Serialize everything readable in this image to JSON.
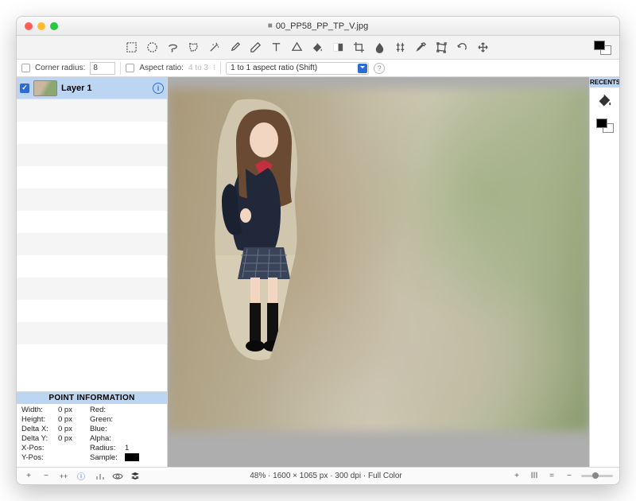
{
  "window": {
    "modified_mark": "■",
    "title": "00_PP58_PP_TP_V.jpg"
  },
  "optionbar": {
    "corner_radius_label": "Corner radius:",
    "corner_radius_value": "8",
    "aspect_label": "Aspect ratio:",
    "aspect_value": "4 to 3",
    "preset_value": "1 to 1 aspect ratio (Shift)"
  },
  "layers": {
    "items": [
      {
        "name": "Layer 1",
        "visible": true
      }
    ]
  },
  "point_info": {
    "header": "POINT INFORMATION",
    "width_label": "Width:",
    "width_value": "0 px",
    "height_label": "Height:",
    "height_value": "0 px",
    "deltax_label": "Delta X:",
    "deltax_value": "0 px",
    "deltay_label": "Delta Y:",
    "deltay_value": "0 px",
    "xpos_label": "X-Pos:",
    "xpos_value": "",
    "ypos_label": "Y-Pos:",
    "ypos_value": "",
    "red_label": "Red:",
    "green_label": "Green:",
    "blue_label": "Blue:",
    "alpha_label": "Alpha:",
    "radius_label": "Radius:",
    "radius_value": "1",
    "sample_label": "Sample:"
  },
  "recents": {
    "header": "RECENTS"
  },
  "status": {
    "zoom": "48%",
    "dims": "1600 × 1065 px",
    "dpi": "300 dpi",
    "mode": "Full Color"
  }
}
